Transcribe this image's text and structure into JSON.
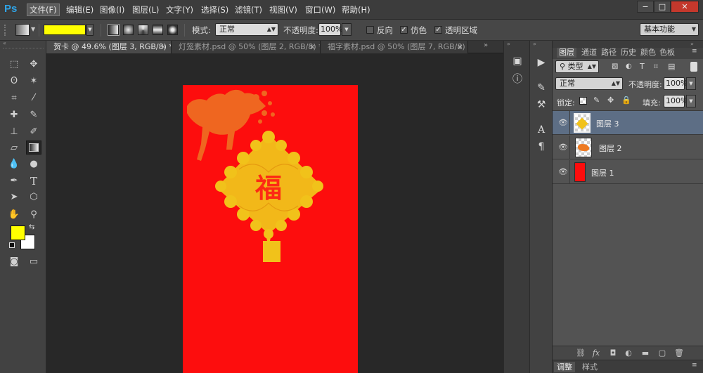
{
  "app": {
    "logo": "Ps",
    "menu": [
      "文件(F)",
      "编辑(E)",
      "图像(I)",
      "图层(L)",
      "文字(Y)",
      "选择(S)",
      "滤镜(T)",
      "视图(V)",
      "窗口(W)",
      "帮助(H)"
    ],
    "window_buttons": [
      "−",
      "□",
      "✕"
    ]
  },
  "options": {
    "gradient_color": "#ffff00",
    "mode_label": "模式:",
    "mode_value": "正常",
    "opacity_label": "不透明度:",
    "opacity_value": "100%",
    "reverse_label": "反向",
    "dither_label": "仿色",
    "transparency_label": "透明区域",
    "reverse_checked": false,
    "dither_checked": true,
    "transparency_checked": true,
    "workspace_value": "基本功能"
  },
  "tabs": [
    {
      "label": "贺卡 @ 49.6% (图层 3, RGB/8) *",
      "close": "×"
    },
    {
      "label": "灯笼素材.psd @ 50% (图层 2, RGB/8) *",
      "close": "×"
    },
    {
      "label": "福字素材.psd @ 50% (图层 7, RGB/8) *",
      "close": "×"
    }
  ],
  "tools": {
    "foreground_color": "#ffff00",
    "background_color": "#ffffff"
  },
  "canvas": {
    "background_color": "#fd0d0d",
    "fu_character": "福"
  },
  "layers_panel": {
    "tabs": [
      "图层",
      "通道",
      "路径",
      "历史",
      "颜色",
      "色板"
    ],
    "filter_label": "类型",
    "blend_mode": "正常",
    "opacity_label": "不透明度:",
    "opacity_value": "100%",
    "lock_label": "锁定:",
    "fill_label": "填充:",
    "fill_value": "100%",
    "layers": [
      {
        "name": "图层 3",
        "selected": true
      },
      {
        "name": "图层 2",
        "selected": false
      },
      {
        "name": "图层 1",
        "selected": false
      }
    ],
    "bottom_tabs": [
      "调整",
      "样式"
    ]
  }
}
